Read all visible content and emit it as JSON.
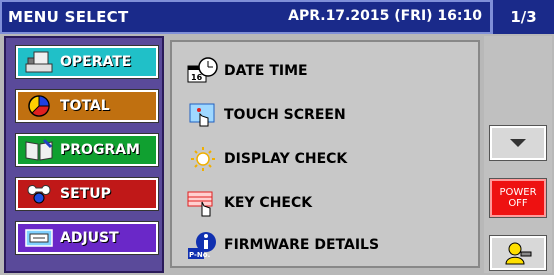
{
  "header": {
    "title": "MENU SELECT",
    "datetime": "APR.17.2015 (FRI)  16:10",
    "page": "1/3"
  },
  "sidebar": {
    "items": [
      {
        "label": "OPERATE",
        "color": "#20c0c8",
        "icon": "operate-icon"
      },
      {
        "label": "TOTAL",
        "color": "#c07010",
        "icon": "pie-chart-icon"
      },
      {
        "label": "PROGRAM",
        "color": "#10a030",
        "icon": "book-icon"
      },
      {
        "label": "SETUP",
        "color": "#c01818",
        "icon": "wrench-icon"
      },
      {
        "label": "ADJUST",
        "color": "#6a28c8",
        "icon": "adjust-icon"
      }
    ]
  },
  "menu": {
    "items": [
      {
        "label": "DATE TIME",
        "icon": "calendar-clock-icon"
      },
      {
        "label": "TOUCH SCREEN",
        "icon": "touch-icon"
      },
      {
        "label": "DISPLAY CHECK",
        "icon": "sun-icon"
      },
      {
        "label": "KEY CHECK",
        "icon": "key-check-icon"
      },
      {
        "label": "FIRMWARE DETAILS",
        "icon": "info-icon",
        "badge": "P-No."
      }
    ]
  },
  "right": {
    "power_line1": "POWER",
    "power_line2": "OFF",
    "down_icon": "arrow-down-icon",
    "user_icon": "user-key-icon"
  },
  "colors": {
    "title_bg": "#1a2a8a",
    "power": "#ee1111"
  }
}
